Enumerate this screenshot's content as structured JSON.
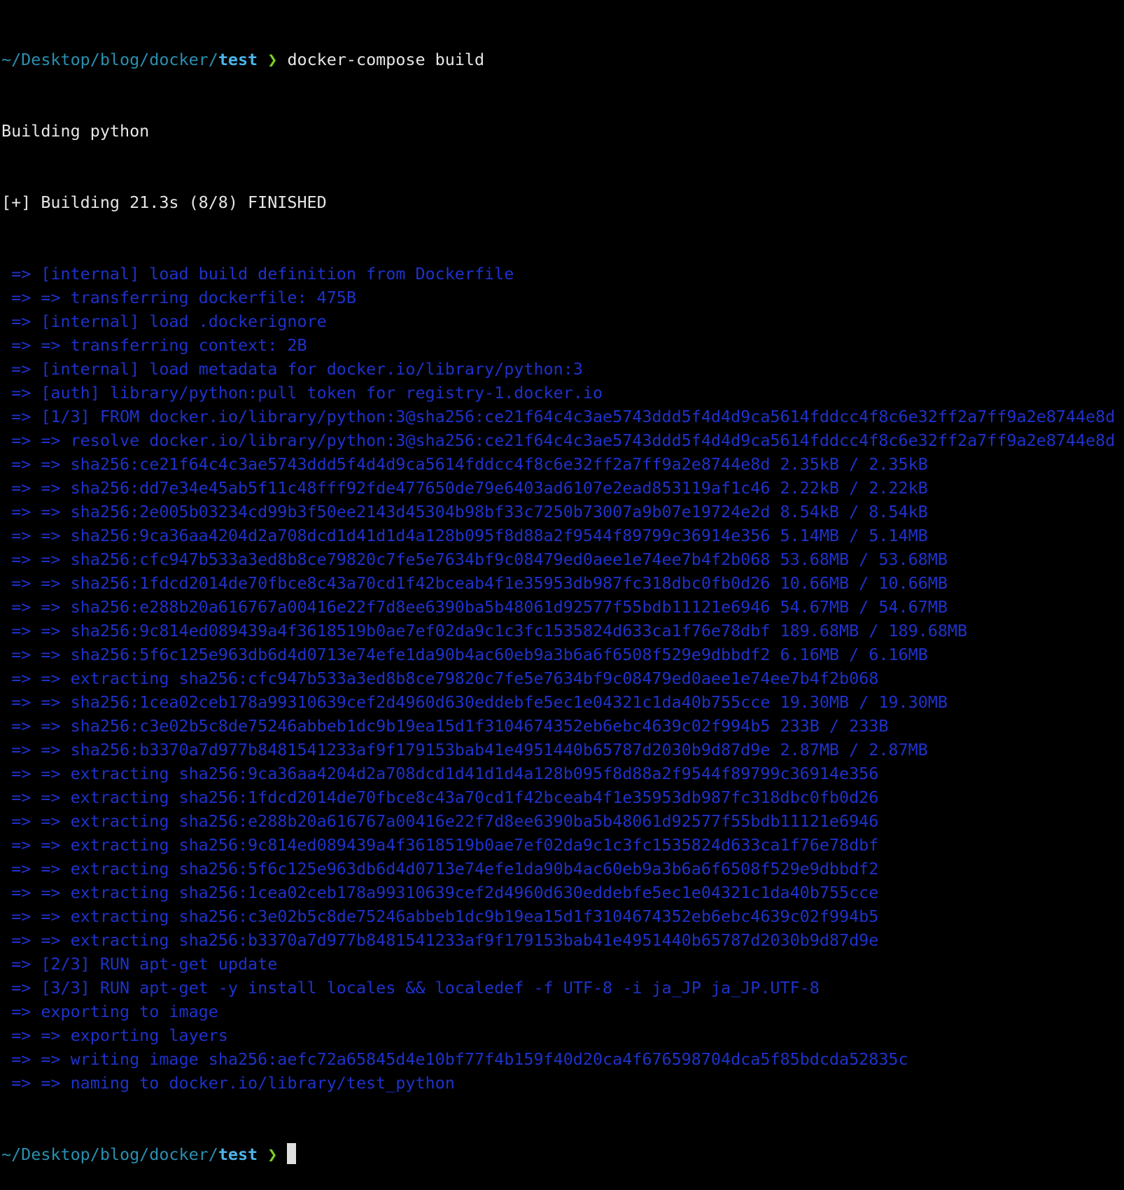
{
  "colors": {
    "background": "#000000",
    "text": "#e6e6e6",
    "build_output": "#1e32cc",
    "path": "#2a8fb0",
    "current_dir": "#4db5ea",
    "prompt_chevron": "#7ed321"
  },
  "prompt": {
    "path": "~/Desktop/blog/docker/",
    "dir": "test",
    "chevron": "❯",
    "command": "docker-compose build"
  },
  "header_lines": [
    "Building python",
    "[+] Building 21.3s (8/8) FINISHED"
  ],
  "output_lines": [
    " => [internal] load build definition from Dockerfile",
    " => => transferring dockerfile: 475B",
    " => [internal] load .dockerignore",
    " => => transferring context: 2B",
    " => [internal] load metadata for docker.io/library/python:3",
    " => [auth] library/python:pull token for registry-1.docker.io",
    " => [1/3] FROM docker.io/library/python:3@sha256:ce21f64c4c3ae5743ddd5f4d4d9ca5614fddcc4f8c6e32ff2a7ff9a2e8744e8d",
    " => => resolve docker.io/library/python:3@sha256:ce21f64c4c3ae5743ddd5f4d4d9ca5614fddcc4f8c6e32ff2a7ff9a2e8744e8d",
    " => => sha256:ce21f64c4c3ae5743ddd5f4d4d9ca5614fddcc4f8c6e32ff2a7ff9a2e8744e8d 2.35kB / 2.35kB",
    " => => sha256:dd7e34e45ab5f11c48fff92fde477650de79e6403ad6107e2ead853119af1c46 2.22kB / 2.22kB",
    " => => sha256:2e005b03234cd99b3f50ee2143d45304b98bf33c7250b73007a9b07e19724e2d 8.54kB / 8.54kB",
    " => => sha256:9ca36aa4204d2a708dcd1d41d1d4a128b095f8d88a2f9544f89799c36914e356 5.14MB / 5.14MB",
    " => => sha256:cfc947b533a3ed8b8ce79820c7fe5e7634bf9c08479ed0aee1e74ee7b4f2b068 53.68MB / 53.68MB",
    " => => sha256:1fdcd2014de70fbce8c43a70cd1f42bceab4f1e35953db987fc318dbc0fb0d26 10.66MB / 10.66MB",
    " => => sha256:e288b20a616767a00416e22f7d8ee6390ba5b48061d92577f55bdb11121e6946 54.67MB / 54.67MB",
    " => => sha256:9c814ed089439a4f3618519b0ae7ef02da9c1c3fc1535824d633ca1f76e78dbf 189.68MB / 189.68MB",
    " => => sha256:5f6c125e963db6d4d0713e74efe1da90b4ac60eb9a3b6a6f6508f529e9dbbdf2 6.16MB / 6.16MB",
    " => => extracting sha256:cfc947b533a3ed8b8ce79820c7fe5e7634bf9c08479ed0aee1e74ee7b4f2b068",
    " => => sha256:1cea02ceb178a99310639cef2d4960d630eddebfe5ec1e04321c1da40b755cce 19.30MB / 19.30MB",
    " => => sha256:c3e02b5c8de75246abbeb1dc9b19ea15d1f3104674352eb6ebc4639c02f994b5 233B / 233B",
    " => => sha256:b3370a7d977b8481541233af9f179153bab41e4951440b65787d2030b9d87d9e 2.87MB / 2.87MB",
    " => => extracting sha256:9ca36aa4204d2a708dcd1d41d1d4a128b095f8d88a2f9544f89799c36914e356",
    " => => extracting sha256:1fdcd2014de70fbce8c43a70cd1f42bceab4f1e35953db987fc318dbc0fb0d26",
    " => => extracting sha256:e288b20a616767a00416e22f7d8ee6390ba5b48061d92577f55bdb11121e6946",
    " => => extracting sha256:9c814ed089439a4f3618519b0ae7ef02da9c1c3fc1535824d633ca1f76e78dbf",
    " => => extracting sha256:5f6c125e963db6d4d0713e74efe1da90b4ac60eb9a3b6a6f6508f529e9dbbdf2",
    " => => extracting sha256:1cea02ceb178a99310639cef2d4960d630eddebfe5ec1e04321c1da40b755cce",
    " => => extracting sha256:c3e02b5c8de75246abbeb1dc9b19ea15d1f3104674352eb6ebc4639c02f994b5",
    " => => extracting sha256:b3370a7d977b8481541233af9f179153bab41e4951440b65787d2030b9d87d9e",
    " => [2/3] RUN apt-get update",
    " => [3/3] RUN apt-get -y install locales && localedef -f UTF-8 -i ja_JP ja_JP.UTF-8",
    " => exporting to image",
    " => => exporting layers",
    " => => writing image sha256:aefc72a65845d4e10bf77f4b159f40d20ca4f676598704dca5f85bdcda52835c",
    " => => naming to docker.io/library/test_python"
  ]
}
